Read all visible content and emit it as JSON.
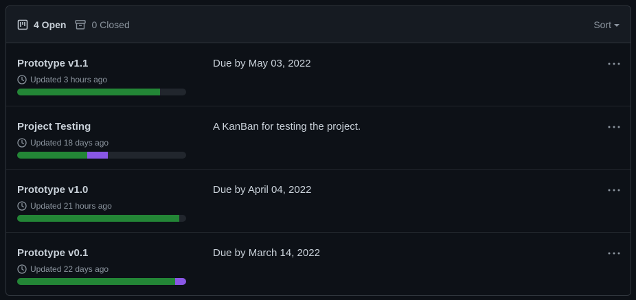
{
  "header": {
    "open_label": "4 Open",
    "closed_label": "0 Closed",
    "sort_label": "Sort",
    "open_icon": "project-icon",
    "closed_icon": "archive-icon"
  },
  "colors": {
    "done": "#238636",
    "in_progress": "#8957e5",
    "track": "#21262d"
  },
  "projects": [
    {
      "title": "Prototype v1.1",
      "updated": "Updated 3 hours ago",
      "description": "Due by May 03, 2022",
      "progress": {
        "done": 84.5,
        "in_progress": 0
      }
    },
    {
      "title": "Project Testing",
      "updated": "Updated 18 days ago",
      "description": "A KanBan for testing the project.",
      "progress": {
        "done": 41.5,
        "in_progress": 12
      }
    },
    {
      "title": "Prototype v1.0",
      "updated": "Updated 21 hours ago",
      "description": "Due by April 04, 2022",
      "progress": {
        "done": 96,
        "in_progress": 0
      }
    },
    {
      "title": "Prototype v0.1",
      "updated": "Updated 22 days ago",
      "description": "Due by March 14, 2022",
      "progress": {
        "done": 93.5,
        "in_progress": 6.5
      }
    }
  ]
}
